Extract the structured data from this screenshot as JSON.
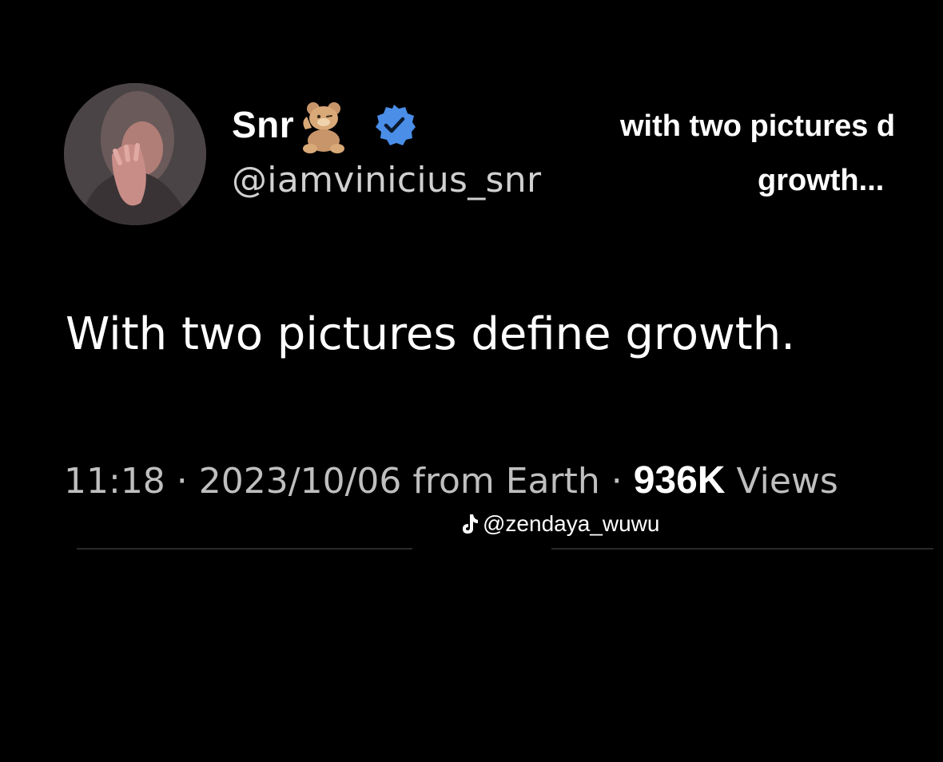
{
  "author": {
    "display_name": "Snr",
    "emoji_icon": "teddy-bear-icon",
    "verified_icon": "verified-badge-icon",
    "handle": "@iamvinicius_snr"
  },
  "overlay_caption": {
    "line1": "with two pictures d",
    "line2": "growth..."
  },
  "tweet": {
    "text": "With two pictures define growth."
  },
  "meta": {
    "time": "11:18",
    "separator": " · ",
    "date": "2023/10/06",
    "source": " from Earth",
    "views_count": "936K",
    "views_label": " Views"
  },
  "watermark": {
    "icon": "tiktok-icon",
    "handle": "@zendaya_wuwu"
  },
  "colors": {
    "background": "#000000",
    "verified_blue": "#4a8ee8",
    "secondary_text": "#bfbfbf"
  }
}
